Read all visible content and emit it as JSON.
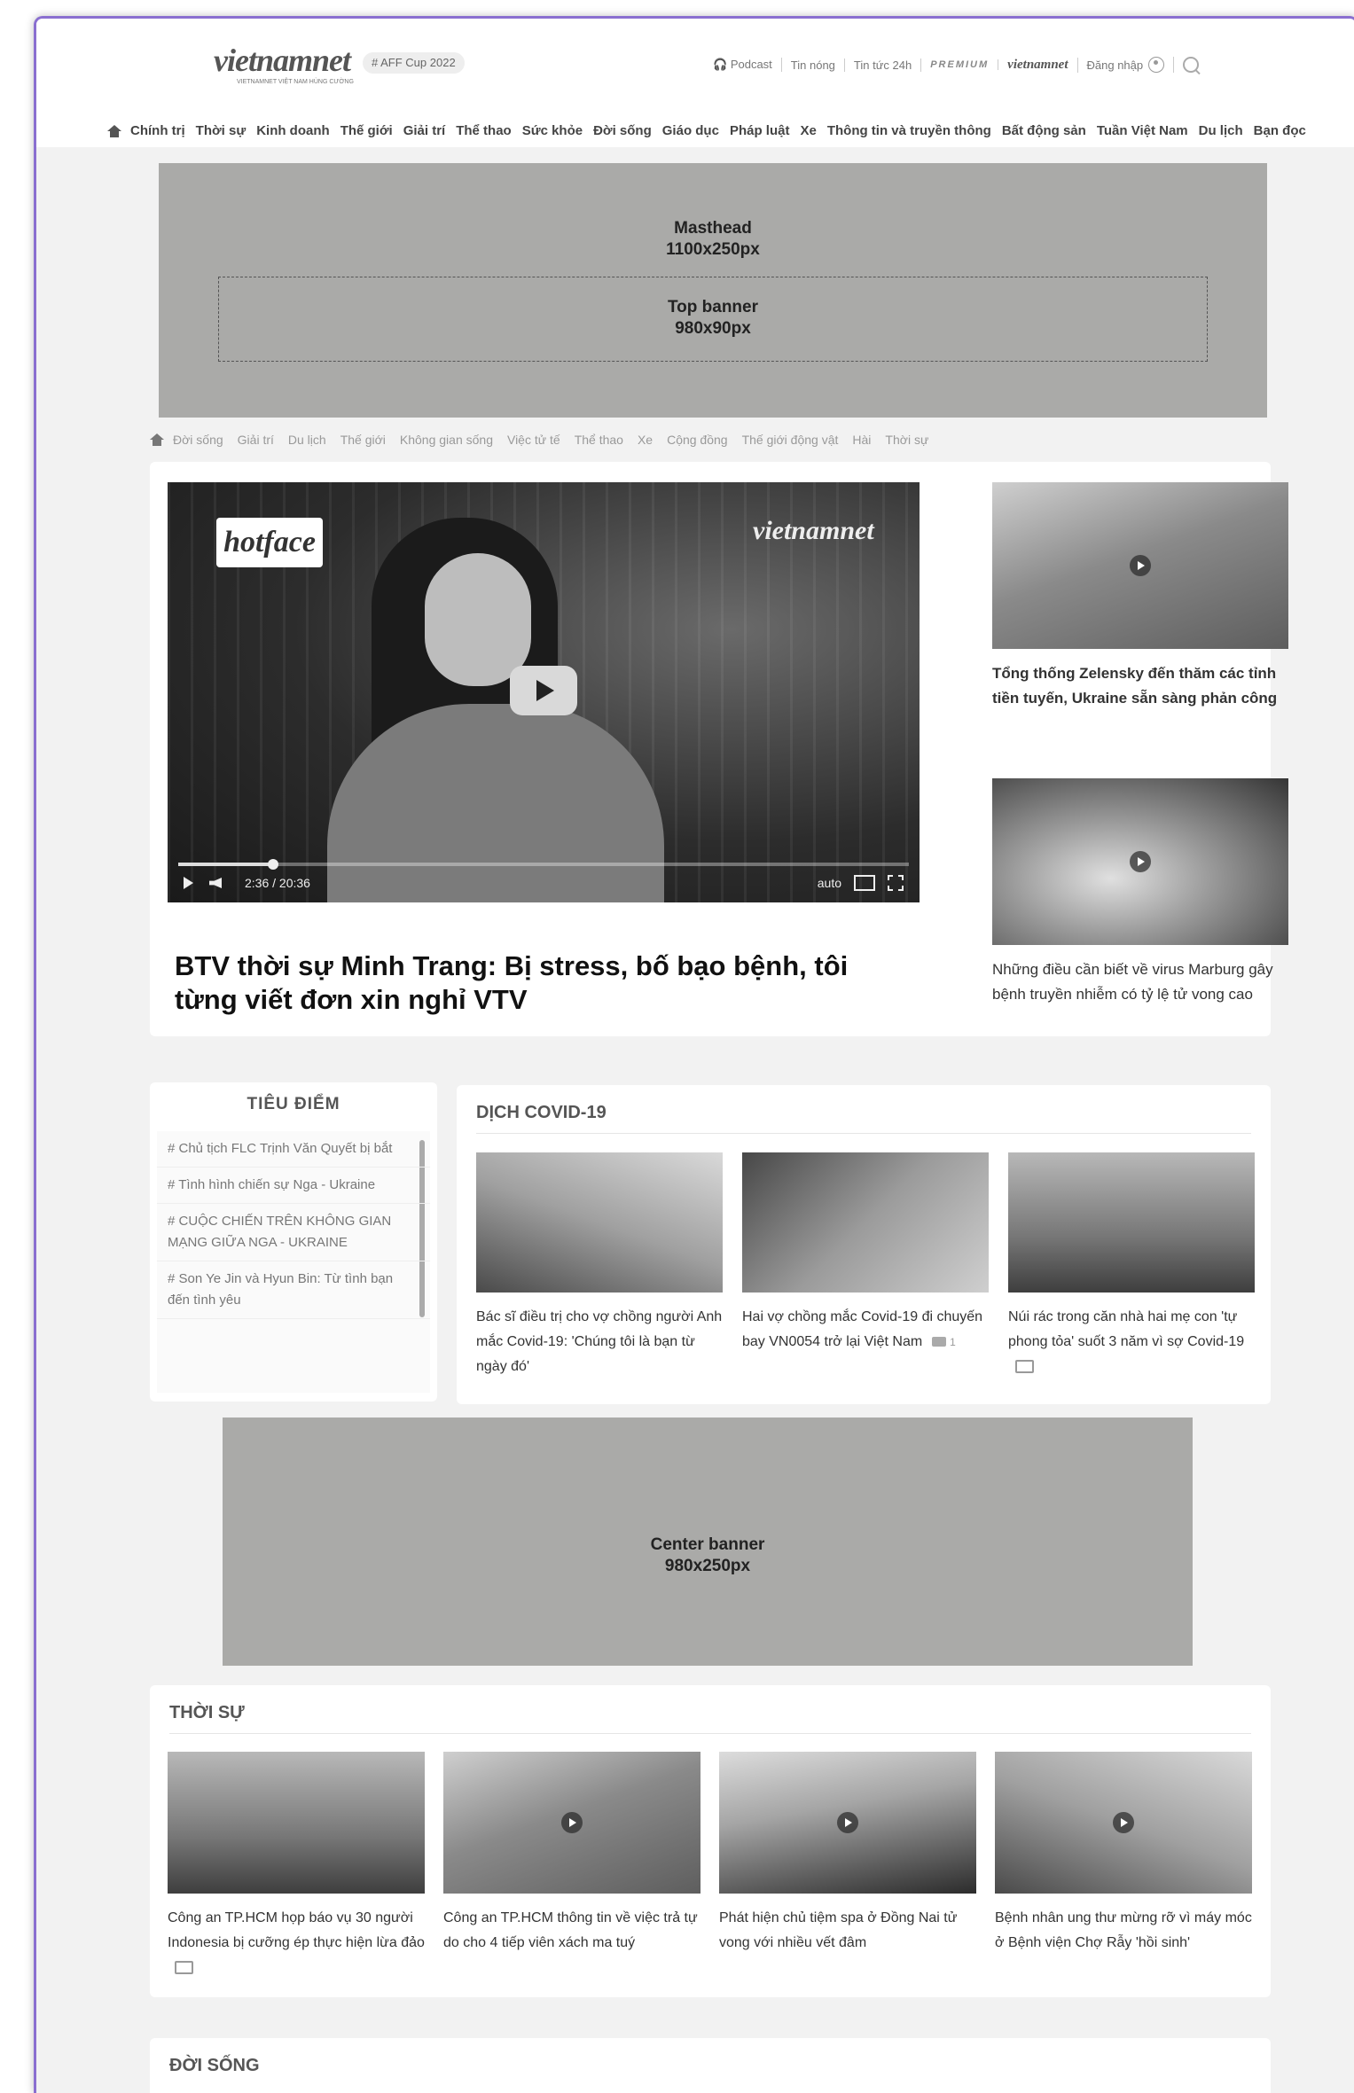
{
  "header": {
    "logo_text": "vietnamnet",
    "logo_sub": "VIETNAMNET VIỆT NAM HÙNG CƯỜNG",
    "tag": "# AFF Cup 2022",
    "links": {
      "podcast": "Podcast",
      "hot": "Tin nóng",
      "news24": "Tin tức 24h",
      "premium": "PREMIUM",
      "vnn_tv": "vietnamnet",
      "login": "Đăng nhập"
    }
  },
  "nav": [
    "Chính trị",
    "Thời sự",
    "Kinh doanh",
    "Thế giới",
    "Giải trí",
    "Thể thao",
    "Sức khỏe",
    "Đời sống",
    "Giáo dục",
    "Pháp luật",
    "Xe",
    "Thông tin và truyền thông",
    "Bất động sản",
    "Tuần Việt Nam",
    "Du lịch",
    "Bạn đọc"
  ],
  "ads": {
    "masthead": "Masthead",
    "masthead_size": "1100x250px",
    "top_banner": "Top banner",
    "top_banner_size": "980x90px",
    "center_banner": "Center banner",
    "center_banner_size": "980x250px"
  },
  "subnav": [
    "Đời sống",
    "Giải trí",
    "Du lịch",
    "Thế giới",
    "Không gian sống",
    "Việc tử tế",
    "Thể thao",
    "Xe",
    "Cộng đồng",
    "Thế giới động vật",
    "Hài",
    "Thời sự"
  ],
  "hero": {
    "video": {
      "brand": "hotface",
      "channel": "vietnamnet",
      "time_current": "2:36",
      "time_sep": "/",
      "time_total": "20:36",
      "quality": "auto",
      "progress": 0.13
    },
    "title": "BTV thời sự Minh Trang: Bị stress, bố bạo bệnh, tôi từng viết đơn xin nghỉ VTV",
    "side": [
      {
        "title": "Tổng thống Zelensky đến thăm các tỉnh tiền tuyến, Ukraine sẵn sàng phản công"
      },
      {
        "title": "Những điều cần biết về virus Marburg gây bệnh truyền nhiễm có tỷ lệ tử vong cao"
      }
    ]
  },
  "focus": {
    "title": "TIÊU ĐIỂM",
    "items": [
      "# Chủ tịch FLC Trịnh Văn Quyết bị bắt",
      "# Tình hình chiến sự Nga - Ukraine",
      "# CUỘC CHIẾN TRÊN KHÔNG GIAN MẠNG GIỮA NGA - UKRAINE",
      "# Son Ye Jin và Hyun Bin: Từ tình bạn đến tình yêu"
    ]
  },
  "covid": {
    "title": "DỊCH COVID-19",
    "articles": [
      {
        "title": "Bác sĩ điều trị cho vợ chồng người Anh mắc Covid-19: 'Chúng tôi là bạn từ ngày đó'"
      },
      {
        "title": "Hai vợ chồng mắc Covid-19 đi chuyến bay VN0054 trở lại Việt Nam",
        "comments": "1"
      },
      {
        "title": "Núi rác trong căn nhà hai mẹ con 'tự phong tỏa' suốt 3 năm vì sợ Covid-19"
      }
    ]
  },
  "thoisu": {
    "title": "THỜI SỰ",
    "articles": [
      {
        "title": "Công an TP.HCM họp báo vụ 30 người Indonesia bị cưỡng ép thực hiện lừa đảo"
      },
      {
        "title": "Công an TP.HCM thông tin về việc trả tự do cho 4 tiếp viên xách ma tuý"
      },
      {
        "title": "Phát hiện chủ tiệm spa ở Đồng Nai tử vong với nhiều vết đâm"
      },
      {
        "title": "Bệnh nhân ung thư mừng rỡ vì máy móc ở Bệnh viện Chợ Rẫy 'hồi sinh'"
      }
    ]
  },
  "doisong": {
    "title": "ĐỜI SỐNG"
  }
}
